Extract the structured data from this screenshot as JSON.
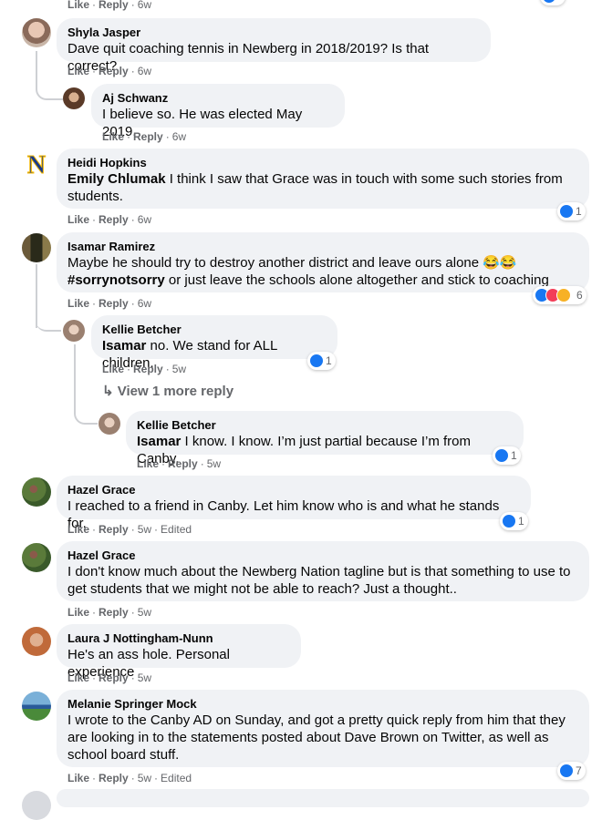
{
  "top_partial": {
    "like": "Like",
    "reply": "Reply",
    "time": "6w"
  },
  "comments": {
    "c1": {
      "name": "Shyla Jasper",
      "text": "Dave quit coaching tennis in Newberg in 2018/2019? Is that correct?",
      "like": "Like",
      "reply": "Reply",
      "time": "6w"
    },
    "c1r1": {
      "name": "Aj Schwanz",
      "text": "I believe so. He was elected May 2019.",
      "like": "Like",
      "reply": "Reply",
      "time": "6w"
    },
    "c2": {
      "name": "Heidi Hopkins",
      "mention": "Emily Chlumak",
      "text": " I think I saw that Grace was in touch with some such stories from students.",
      "like": "Like",
      "reply": "Reply",
      "time": "6w",
      "reactions": "1"
    },
    "c3": {
      "name": "Isamar Ramirez",
      "text1": "Maybe he should try to destroy another district and leave ours alone 😂😂",
      "hashtag": "#sorrynotsorry",
      "text2": " or just leave the schools alone altogether and stick to coaching",
      "like": "Like",
      "reply": "Reply",
      "time": "6w",
      "reactions": "6"
    },
    "c3r1": {
      "name": "Kellie Betcher",
      "mention": "Isamar",
      "text": " no. We stand for ALL children.",
      "like": "Like",
      "reply": "Reply",
      "time": "5w",
      "reactions": "1"
    },
    "c3more": {
      "label": "View 1 more reply"
    },
    "c3r2": {
      "name": "Kellie Betcher",
      "mention": "Isamar",
      "text": " I know. I know. I’m just partial because I’m from Canby.",
      "like": "Like",
      "reply": "Reply",
      "time": "5w",
      "reactions": "1"
    },
    "c4": {
      "name": "Hazel Grace",
      "text": "I reached to a friend in Canby. Let him know who is and what he stands for.",
      "like": "Like",
      "reply": "Reply",
      "time": "5w",
      "edited": "Edited",
      "reactions": "1"
    },
    "c5": {
      "name": "Hazel Grace",
      "text": "I don't know much about the Newberg Nation tagline but is that something to use to get students that we might not be able to reach? Just a thought..",
      "like": "Like",
      "reply": "Reply",
      "time": "5w"
    },
    "c6": {
      "name": "Laura J Nottingham-Nunn",
      "text": "He's an ass hole. Personal experience",
      "like": "Like",
      "reply": "Reply",
      "time": "5w"
    },
    "c7": {
      "name": "Melanie Springer Mock",
      "text": "I wrote to the Canby AD on Sunday, and got a pretty quick reply from him that they are looking in to the statements posted about Dave Brown on Twitter, as well as school board stuff.",
      "like": "Like",
      "reply": "Reply",
      "time": "5w",
      "edited": "Edited",
      "reactions": "7"
    }
  },
  "avatar_letters": {
    "heidi": "N"
  },
  "colors": {
    "like": "#1877f2",
    "love": "#f33e58",
    "care": "#f7b125",
    "bubble": "#f0f2f5",
    "meta": "#65676b"
  }
}
